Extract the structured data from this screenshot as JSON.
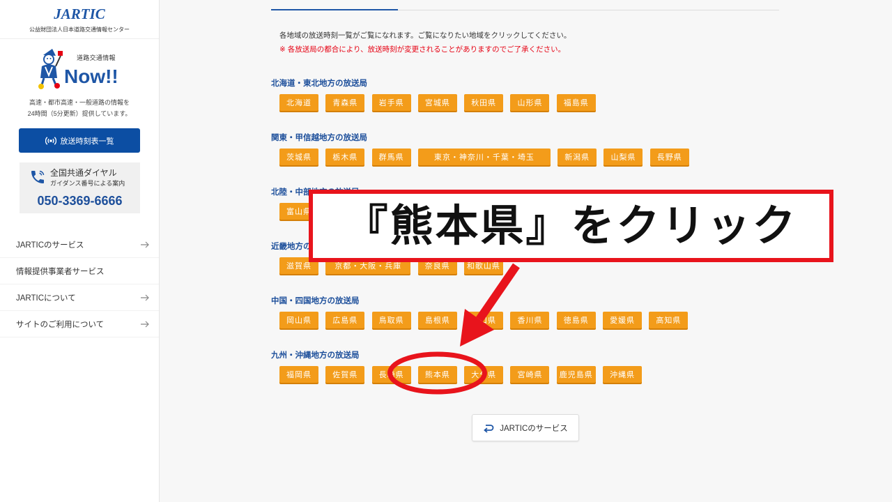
{
  "sidebar": {
    "logo": "JARTIC",
    "org_name": "公益財団法人日本道路交通情報センター",
    "now_label": "道路交通情報",
    "now_title": "Now!!",
    "description": [
      "高速・都市高速・一般道路の情報を",
      "24時間（5分更新）提供しています。"
    ],
    "schedule_button": "放送時刻表一覧",
    "dial": {
      "title": "全国共通ダイヤル",
      "subtitle": "ガイダンス番号による案内",
      "number": "050-3369-6666"
    },
    "nav": [
      {
        "label": "JARTICのサービス",
        "arrow": true
      },
      {
        "label": "情報提供事業者サービス",
        "arrow": false
      },
      {
        "label": "JARTICについて",
        "arrow": true
      },
      {
        "label": "サイトのご利用について",
        "arrow": true
      }
    ]
  },
  "main": {
    "intro": "各地域の放送時刻一覧がご覧になれます。ご覧になりたい地域をクリックしてください。",
    "notice": "※ 各放送局の都合により、放送時刻が変更されることがありますのでご了承ください。",
    "regions": [
      {
        "heading": "北海道・東北地方の放送局",
        "stations": [
          "北海道",
          "青森県",
          "岩手県",
          "宮城県",
          "秋田県",
          "山形県",
          "福島県"
        ]
      },
      {
        "heading": "関東・甲信越地方の放送局",
        "stations": [
          "茨城県",
          "栃木県",
          "群馬県",
          "東京・神奈川・千葉・埼玉",
          "新潟県",
          "山梨県",
          "長野県"
        ]
      },
      {
        "heading": "北陸・中部地方の放送局",
        "stations": [
          "富山県"
        ]
      },
      {
        "heading": "近畿地方の放送局",
        "stations": [
          "滋賀県",
          "京都・大阪・兵庫",
          "奈良県",
          "和歌山県"
        ]
      },
      {
        "heading": "中国・四国地方の放送局",
        "stations": [
          "岡山県",
          "広島県",
          "鳥取県",
          "島根県",
          "山口県",
          "香川県",
          "徳島県",
          "愛媛県",
          "高知県"
        ]
      },
      {
        "heading": "九州・沖縄地方の放送局",
        "stations": [
          "福岡県",
          "佐賀県",
          "長崎県",
          "熊本県",
          "大分県",
          "宮崎県",
          "鹿児島県",
          "沖縄県"
        ]
      }
    ],
    "service_button": "JARTICのサービス"
  },
  "annotation": {
    "callout": "『熊本県』をクリック"
  },
  "icons": {
    "mascot": "mascot-icon",
    "schedule_button": "broadcast-icon",
    "dial": "phone-icon",
    "nav_arrow": "arrow-right-icon",
    "service_button": "return-icon"
  },
  "colors": {
    "brand_blue": "#1e56a6",
    "button_blue": "#0c4ea3",
    "heading_blue": "#1d4f9b",
    "station_orange": "#f39c1a",
    "notice_red": "#e60012",
    "annotation_red": "#e8141c",
    "page_background": "#f7f7f7"
  }
}
